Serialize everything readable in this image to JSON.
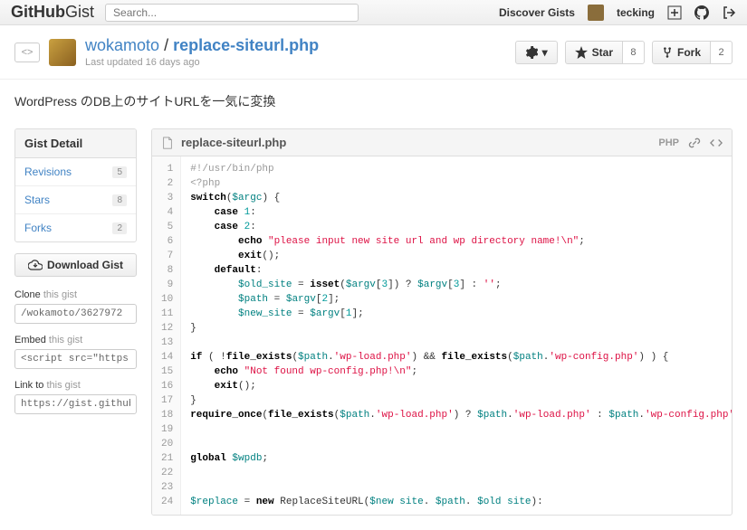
{
  "topbar": {
    "logo_main": "GitHub",
    "logo_sub": "Gist",
    "search_placeholder": "Search...",
    "discover": "Discover Gists",
    "username": "tecking"
  },
  "header": {
    "author": "wokamoto",
    "separator": "/",
    "gist_name": "replace-siteurl.php",
    "updated": "Last updated 16 days ago",
    "gear_caret": "▾",
    "star_label": "Star",
    "star_count": "8",
    "fork_label": "Fork",
    "fork_count": "2"
  },
  "description": "WordPress のDB上のサイトURLを一気に変換",
  "sidebar": {
    "detail_title": "Gist Detail",
    "items": [
      {
        "label": "Revisions",
        "count": "5"
      },
      {
        "label": "Stars",
        "count": "8"
      },
      {
        "label": "Forks",
        "count": "2"
      }
    ],
    "download": "Download Gist",
    "clone_label": "Clone",
    "clone_suffix": "this gist",
    "clone_value": "/wokamoto/3627972",
    "embed_label": "Embed",
    "embed_suffix": "this gist",
    "embed_value": "<script src=\"https:.",
    "link_label": "Link to",
    "link_suffix": "this gist",
    "link_value": "https://gist.github"
  },
  "file": {
    "name": "replace-siteurl.php",
    "lang": "PHP"
  },
  "code": {
    "lines": [
      {
        "n": "1",
        "t": [
          {
            "c": "c",
            "v": "#!/usr/bin/php"
          }
        ]
      },
      {
        "n": "2",
        "t": [
          {
            "c": "c",
            "v": "<?php"
          }
        ]
      },
      {
        "n": "3",
        "t": [
          {
            "c": "k",
            "v": "switch"
          },
          {
            "c": "",
            "v": "("
          },
          {
            "c": "nv",
            "v": "$argc"
          },
          {
            "c": "",
            "v": ") {"
          }
        ]
      },
      {
        "n": "4",
        "t": [
          {
            "c": "",
            "v": "    "
          },
          {
            "c": "k",
            "v": "case"
          },
          {
            "c": "",
            "v": " "
          },
          {
            "c": "mi",
            "v": "1"
          },
          {
            "c": "",
            "v": ":"
          }
        ]
      },
      {
        "n": "5",
        "t": [
          {
            "c": "",
            "v": "    "
          },
          {
            "c": "k",
            "v": "case"
          },
          {
            "c": "",
            "v": " "
          },
          {
            "c": "mi",
            "v": "2"
          },
          {
            "c": "",
            "v": ":"
          }
        ]
      },
      {
        "n": "6",
        "t": [
          {
            "c": "",
            "v": "        "
          },
          {
            "c": "k",
            "v": "echo"
          },
          {
            "c": "",
            "v": " "
          },
          {
            "c": "s",
            "v": "\"please input new site url and wp directory name!\\n\""
          },
          {
            "c": "",
            "v": ";"
          }
        ]
      },
      {
        "n": "7",
        "t": [
          {
            "c": "",
            "v": "        "
          },
          {
            "c": "k",
            "v": "exit"
          },
          {
            "c": "",
            "v": "();"
          }
        ]
      },
      {
        "n": "8",
        "t": [
          {
            "c": "",
            "v": "    "
          },
          {
            "c": "k",
            "v": "default"
          },
          {
            "c": "",
            "v": ":"
          }
        ]
      },
      {
        "n": "9",
        "t": [
          {
            "c": "",
            "v": "        "
          },
          {
            "c": "nv",
            "v": "$old_site"
          },
          {
            "c": "",
            "v": " = "
          },
          {
            "c": "k",
            "v": "isset"
          },
          {
            "c": "",
            "v": "("
          },
          {
            "c": "nv",
            "v": "$argv"
          },
          {
            "c": "",
            "v": "["
          },
          {
            "c": "mi",
            "v": "3"
          },
          {
            "c": "",
            "v": "]) ? "
          },
          {
            "c": "nv",
            "v": "$argv"
          },
          {
            "c": "",
            "v": "["
          },
          {
            "c": "mi",
            "v": "3"
          },
          {
            "c": "",
            "v": "] : "
          },
          {
            "c": "s",
            "v": "''"
          },
          {
            "c": "",
            "v": ";"
          }
        ]
      },
      {
        "n": "10",
        "t": [
          {
            "c": "",
            "v": "        "
          },
          {
            "c": "nv",
            "v": "$path"
          },
          {
            "c": "",
            "v": " = "
          },
          {
            "c": "nv",
            "v": "$argv"
          },
          {
            "c": "",
            "v": "["
          },
          {
            "c": "mi",
            "v": "2"
          },
          {
            "c": "",
            "v": "];"
          }
        ]
      },
      {
        "n": "11",
        "t": [
          {
            "c": "",
            "v": "        "
          },
          {
            "c": "nv",
            "v": "$new_site"
          },
          {
            "c": "",
            "v": " = "
          },
          {
            "c": "nv",
            "v": "$argv"
          },
          {
            "c": "",
            "v": "["
          },
          {
            "c": "mi",
            "v": "1"
          },
          {
            "c": "",
            "v": "];"
          }
        ]
      },
      {
        "n": "12",
        "t": [
          {
            "c": "",
            "v": "}"
          }
        ]
      },
      {
        "n": "13",
        "t": [
          {
            "c": "",
            "v": ""
          }
        ]
      },
      {
        "n": "14",
        "t": [
          {
            "c": "k",
            "v": "if"
          },
          {
            "c": "",
            "v": " ( !"
          },
          {
            "c": "k",
            "v": "file_exists"
          },
          {
            "c": "",
            "v": "("
          },
          {
            "c": "nv",
            "v": "$path"
          },
          {
            "c": "",
            "v": "."
          },
          {
            "c": "s",
            "v": "'wp-load.php'"
          },
          {
            "c": "",
            "v": ") && "
          },
          {
            "c": "k",
            "v": "file_exists"
          },
          {
            "c": "",
            "v": "("
          },
          {
            "c": "nv",
            "v": "$path"
          },
          {
            "c": "",
            "v": "."
          },
          {
            "c": "s",
            "v": "'wp-config.php'"
          },
          {
            "c": "",
            "v": ") ) {"
          }
        ]
      },
      {
        "n": "15",
        "t": [
          {
            "c": "",
            "v": "    "
          },
          {
            "c": "k",
            "v": "echo"
          },
          {
            "c": "",
            "v": " "
          },
          {
            "c": "s",
            "v": "\"Not found wp-config.php!\\n\""
          },
          {
            "c": "",
            "v": ";"
          }
        ]
      },
      {
        "n": "16",
        "t": [
          {
            "c": "",
            "v": "    "
          },
          {
            "c": "k",
            "v": "exit"
          },
          {
            "c": "",
            "v": "();"
          }
        ]
      },
      {
        "n": "17",
        "t": [
          {
            "c": "",
            "v": "}"
          }
        ]
      },
      {
        "n": "18",
        "t": [
          {
            "c": "k",
            "v": "require_once"
          },
          {
            "c": "",
            "v": "("
          },
          {
            "c": "k",
            "v": "file_exists"
          },
          {
            "c": "",
            "v": "("
          },
          {
            "c": "nv",
            "v": "$path"
          },
          {
            "c": "",
            "v": "."
          },
          {
            "c": "s",
            "v": "'wp-load.php'"
          },
          {
            "c": "",
            "v": ") ? "
          },
          {
            "c": "nv",
            "v": "$path"
          },
          {
            "c": "",
            "v": "."
          },
          {
            "c": "s",
            "v": "'wp-load.php'"
          },
          {
            "c": "",
            "v": " : "
          },
          {
            "c": "nv",
            "v": "$path"
          },
          {
            "c": "",
            "v": "."
          },
          {
            "c": "s",
            "v": "'wp-config.php'"
          },
          {
            "c": "",
            "v": ");"
          }
        ]
      },
      {
        "n": "19",
        "t": [
          {
            "c": "",
            "v": ""
          }
        ]
      },
      {
        "n": "20",
        "t": [
          {
            "c": "",
            "v": ""
          }
        ]
      },
      {
        "n": "21",
        "t": [
          {
            "c": "k",
            "v": "global"
          },
          {
            "c": "",
            "v": " "
          },
          {
            "c": "nv",
            "v": "$wpdb"
          },
          {
            "c": "",
            "v": ";"
          }
        ]
      },
      {
        "n": "22",
        "t": [
          {
            "c": "",
            "v": ""
          }
        ]
      },
      {
        "n": "23",
        "t": [
          {
            "c": "",
            "v": ""
          }
        ]
      },
      {
        "n": "24",
        "t": [
          {
            "c": "nv",
            "v": "$replace"
          },
          {
            "c": "",
            "v": " = "
          },
          {
            "c": "k",
            "v": "new"
          },
          {
            "c": "",
            "v": " ReplaceSiteURL("
          },
          {
            "c": "nv",
            "v": "$new site"
          },
          {
            "c": "",
            "v": ". "
          },
          {
            "c": "nv",
            "v": "$path"
          },
          {
            "c": "",
            "v": ". "
          },
          {
            "c": "nv",
            "v": "$old site"
          },
          {
            "c": "",
            "v": "):"
          }
        ]
      }
    ]
  }
}
